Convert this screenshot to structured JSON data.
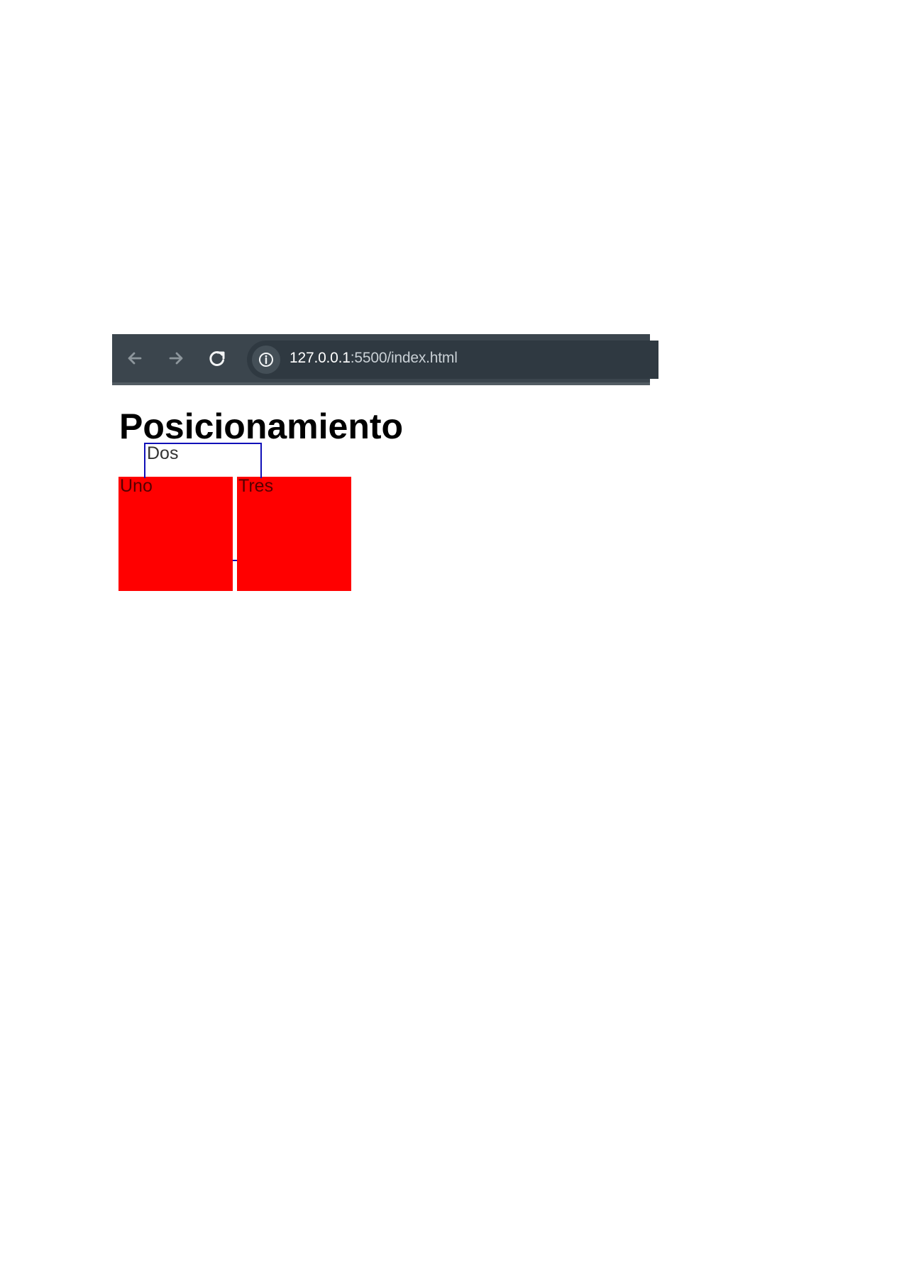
{
  "browser": {
    "url_host": "127.0.0.1",
    "url_path": ":5500/index.html",
    "icons": {
      "back": "arrow-left-icon",
      "forward": "arrow-right-icon",
      "reload": "reload-icon",
      "site_info": "info-icon"
    }
  },
  "page": {
    "heading": "Posicionamiento",
    "boxes": {
      "uno": "Uno",
      "dos": "Dos",
      "tres": "Tres"
    }
  },
  "colors": {
    "toolbar": "#3b454d",
    "box_fill": "#ff0000",
    "outline": "#1010b8",
    "heading": "#000000"
  }
}
